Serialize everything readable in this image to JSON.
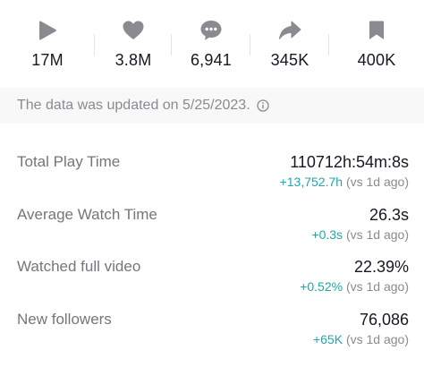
{
  "stats": [
    {
      "icon": "play-icon",
      "value": "17M"
    },
    {
      "icon": "heart-icon",
      "value": "3.8M"
    },
    {
      "icon": "comment-icon",
      "value": "6,941"
    },
    {
      "icon": "share-icon",
      "value": "345K"
    },
    {
      "icon": "bookmark-icon",
      "value": "400K"
    }
  ],
  "banner": {
    "text": "The data was updated on 5/25/2023.",
    "icon": "info-icon"
  },
  "metrics": [
    {
      "label": "Total Play Time",
      "value": "110712h:54m:8s",
      "change": "+13,752.7h",
      "compare": " (vs 1d ago)"
    },
    {
      "label": "Average Watch Time",
      "value": "26.3s",
      "change": "+0.3s",
      "compare": " (vs 1d ago)"
    },
    {
      "label": "Watched full video",
      "value": "22.39%",
      "change": "+0.52%",
      "compare": " (vs 1d ago)"
    },
    {
      "label": "New followers",
      "value": "76,086",
      "change": "+65K",
      "compare": " (vs 1d ago)"
    }
  ],
  "colors": {
    "icon_gray": "#8a8b91",
    "positive_delta": "#20a6a9",
    "banner_bg": "#f8f8f8"
  }
}
